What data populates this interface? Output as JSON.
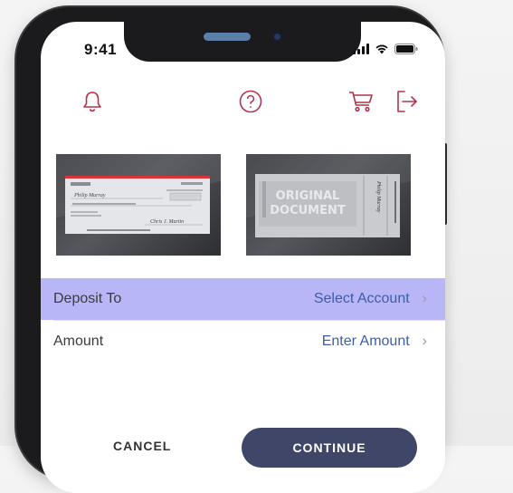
{
  "status_bar": {
    "time": "9:41"
  },
  "toolbar": {
    "icons": [
      "bell-icon",
      "help-icon",
      "cart-icon",
      "logout-icon"
    ],
    "accent_color": "#b0354a"
  },
  "check_images": {
    "front": {
      "payee": "Philip Murray",
      "signature": "Chris J. Martin"
    },
    "back": {
      "watermark_line1": "ORIGINAL",
      "watermark_line2": "DOCUMENT",
      "endorsement": "Philip Murray"
    }
  },
  "form": {
    "deposit_to": {
      "label": "Deposit To",
      "value": "Select Account"
    },
    "amount": {
      "label": "Amount",
      "value": "Enter Amount"
    },
    "highlight_color": "#b9b6f7",
    "value_color": "#3c5ea8"
  },
  "actions": {
    "cancel_label": "CANCEL",
    "continue_label": "CONTINUE"
  }
}
